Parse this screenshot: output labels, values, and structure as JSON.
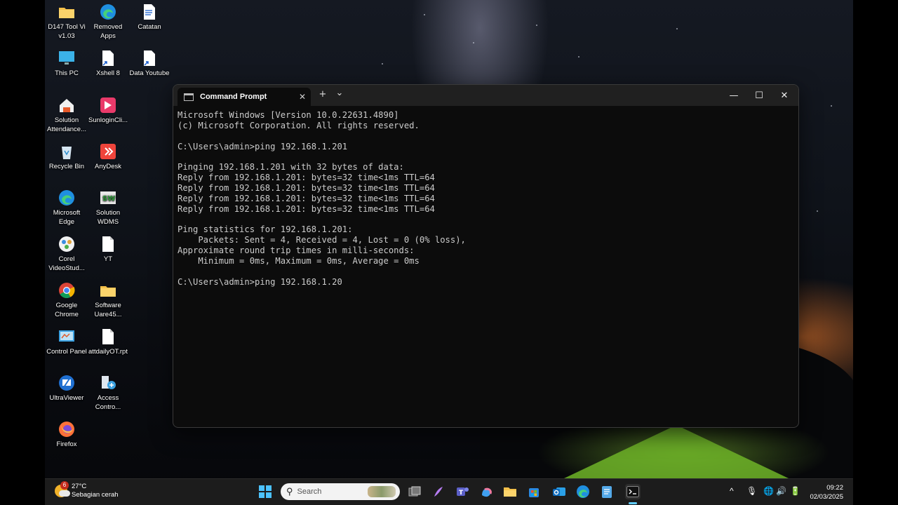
{
  "desktop": {
    "icons": [
      {
        "label": "D147 Tool Vi v1.03",
        "icon": "folder-icon"
      },
      {
        "label": "Removed Apps",
        "icon": "edge-icon"
      },
      {
        "label": "Catatan",
        "icon": "document-shortcut-icon"
      },
      {
        "label": "This PC",
        "icon": "monitor-icon"
      },
      {
        "label": "Xshell 8",
        "icon": "file-shortcut-icon"
      },
      {
        "label": "Data Youtube",
        "icon": "file-shortcut-icon"
      },
      {
        "label": "Solution Attendance...",
        "icon": "house-app-icon"
      },
      {
        "label": "SunloginCli...",
        "icon": "sunlogin-icon"
      },
      {
        "label": "Recycle Bin",
        "icon": "recycle-bin-icon"
      },
      {
        "label": "AnyDesk",
        "icon": "anydesk-icon"
      },
      {
        "label": "Microsoft Edge",
        "icon": "edge-icon"
      },
      {
        "label": "Solution WDMS",
        "icon": "wdms-icon"
      },
      {
        "label": "Corel VideoStud...",
        "icon": "corel-icon"
      },
      {
        "label": "YT",
        "icon": "file-icon"
      },
      {
        "label": "Google Chrome",
        "icon": "chrome-icon"
      },
      {
        "label": "Software Uare45...",
        "icon": "folder-icon"
      },
      {
        "label": "Control Panel",
        "icon": "control-panel-icon"
      },
      {
        "label": "attdailyOT.rpt",
        "icon": "file-icon"
      },
      {
        "label": "UltraViewer",
        "icon": "ultraviewer-icon"
      },
      {
        "label": "Access Contro...",
        "icon": "access-control-icon"
      },
      {
        "label": "Firefox",
        "icon": "firefox-icon"
      }
    ]
  },
  "window": {
    "tab_title": "Command Prompt",
    "tab_close": "✕",
    "new_tab": "+",
    "dropdown": "⌄",
    "minimize": "—",
    "maximize": "☐",
    "close": "✕",
    "console_lines": [
      "Microsoft Windows [Version 10.0.22631.4890]",
      "(c) Microsoft Corporation. All rights reserved.",
      "",
      "C:\\Users\\admin>ping 192.168.1.201",
      "",
      "Pinging 192.168.1.201 with 32 bytes of data:",
      "Reply from 192.168.1.201: bytes=32 time<1ms TTL=64",
      "Reply from 192.168.1.201: bytes=32 time<1ms TTL=64",
      "Reply from 192.168.1.201: bytes=32 time<1ms TTL=64",
      "Reply from 192.168.1.201: bytes=32 time<1ms TTL=64",
      "",
      "Ping statistics for 192.168.1.201:",
      "    Packets: Sent = 4, Received = 4, Lost = 0 (0% loss),",
      "Approximate round trip times in milli-seconds:",
      "    Minimum = 0ms, Maximum = 0ms, Average = 0ms",
      "",
      "C:\\Users\\admin>ping 192.168.1.20"
    ]
  },
  "taskbar": {
    "weather": {
      "temp": "27°C",
      "condition": "Sebagian cerah",
      "badge": "6"
    },
    "search_placeholder": "Search",
    "apps": [
      "start-icon",
      "task-view-icon",
      "copilot-pen-icon",
      "teams-icon",
      "copilot-icon",
      "file-explorer-icon",
      "store-icon",
      "outlook-icon",
      "edge-icon",
      "notepad-icon",
      "terminal-icon"
    ],
    "tray": {
      "chevron": "^",
      "mic": "🎙",
      "network": "🌐",
      "volume": "🔊",
      "battery": "🔋"
    },
    "clock": {
      "time": "09:22",
      "date": "02/03/2025"
    }
  }
}
